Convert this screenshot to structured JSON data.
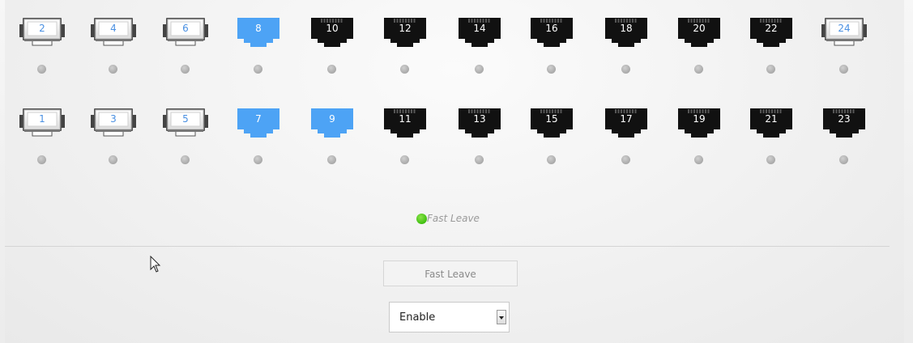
{
  "ports": {
    "top": [
      {
        "num": "2",
        "state": "white"
      },
      {
        "num": "4",
        "state": "white"
      },
      {
        "num": "6",
        "state": "white"
      },
      {
        "num": "8",
        "state": "blue"
      },
      {
        "num": "10",
        "state": "black"
      },
      {
        "num": "12",
        "state": "black"
      },
      {
        "num": "14",
        "state": "black"
      },
      {
        "num": "16",
        "state": "black"
      },
      {
        "num": "18",
        "state": "black"
      },
      {
        "num": "20",
        "state": "black"
      },
      {
        "num": "22",
        "state": "black"
      },
      {
        "num": "24",
        "state": "white"
      }
    ],
    "bottom": [
      {
        "num": "1",
        "state": "white"
      },
      {
        "num": "3",
        "state": "white"
      },
      {
        "num": "5",
        "state": "white"
      },
      {
        "num": "7",
        "state": "blue"
      },
      {
        "num": "9",
        "state": "blue"
      },
      {
        "num": "11",
        "state": "black"
      },
      {
        "num": "13",
        "state": "black"
      },
      {
        "num": "15",
        "state": "black"
      },
      {
        "num": "17",
        "state": "black"
      },
      {
        "num": "19",
        "state": "black"
      },
      {
        "num": "21",
        "state": "black"
      },
      {
        "num": "23",
        "state": "black"
      }
    ]
  },
  "legend": {
    "label": "Fast Leave",
    "color": "#3fbf10"
  },
  "config": {
    "button_label": "Fast Leave",
    "select_value": "Enable"
  },
  "colors": {
    "blue": "#4da3f5",
    "black": "#111111",
    "white_port_number": "#4a90e2"
  }
}
